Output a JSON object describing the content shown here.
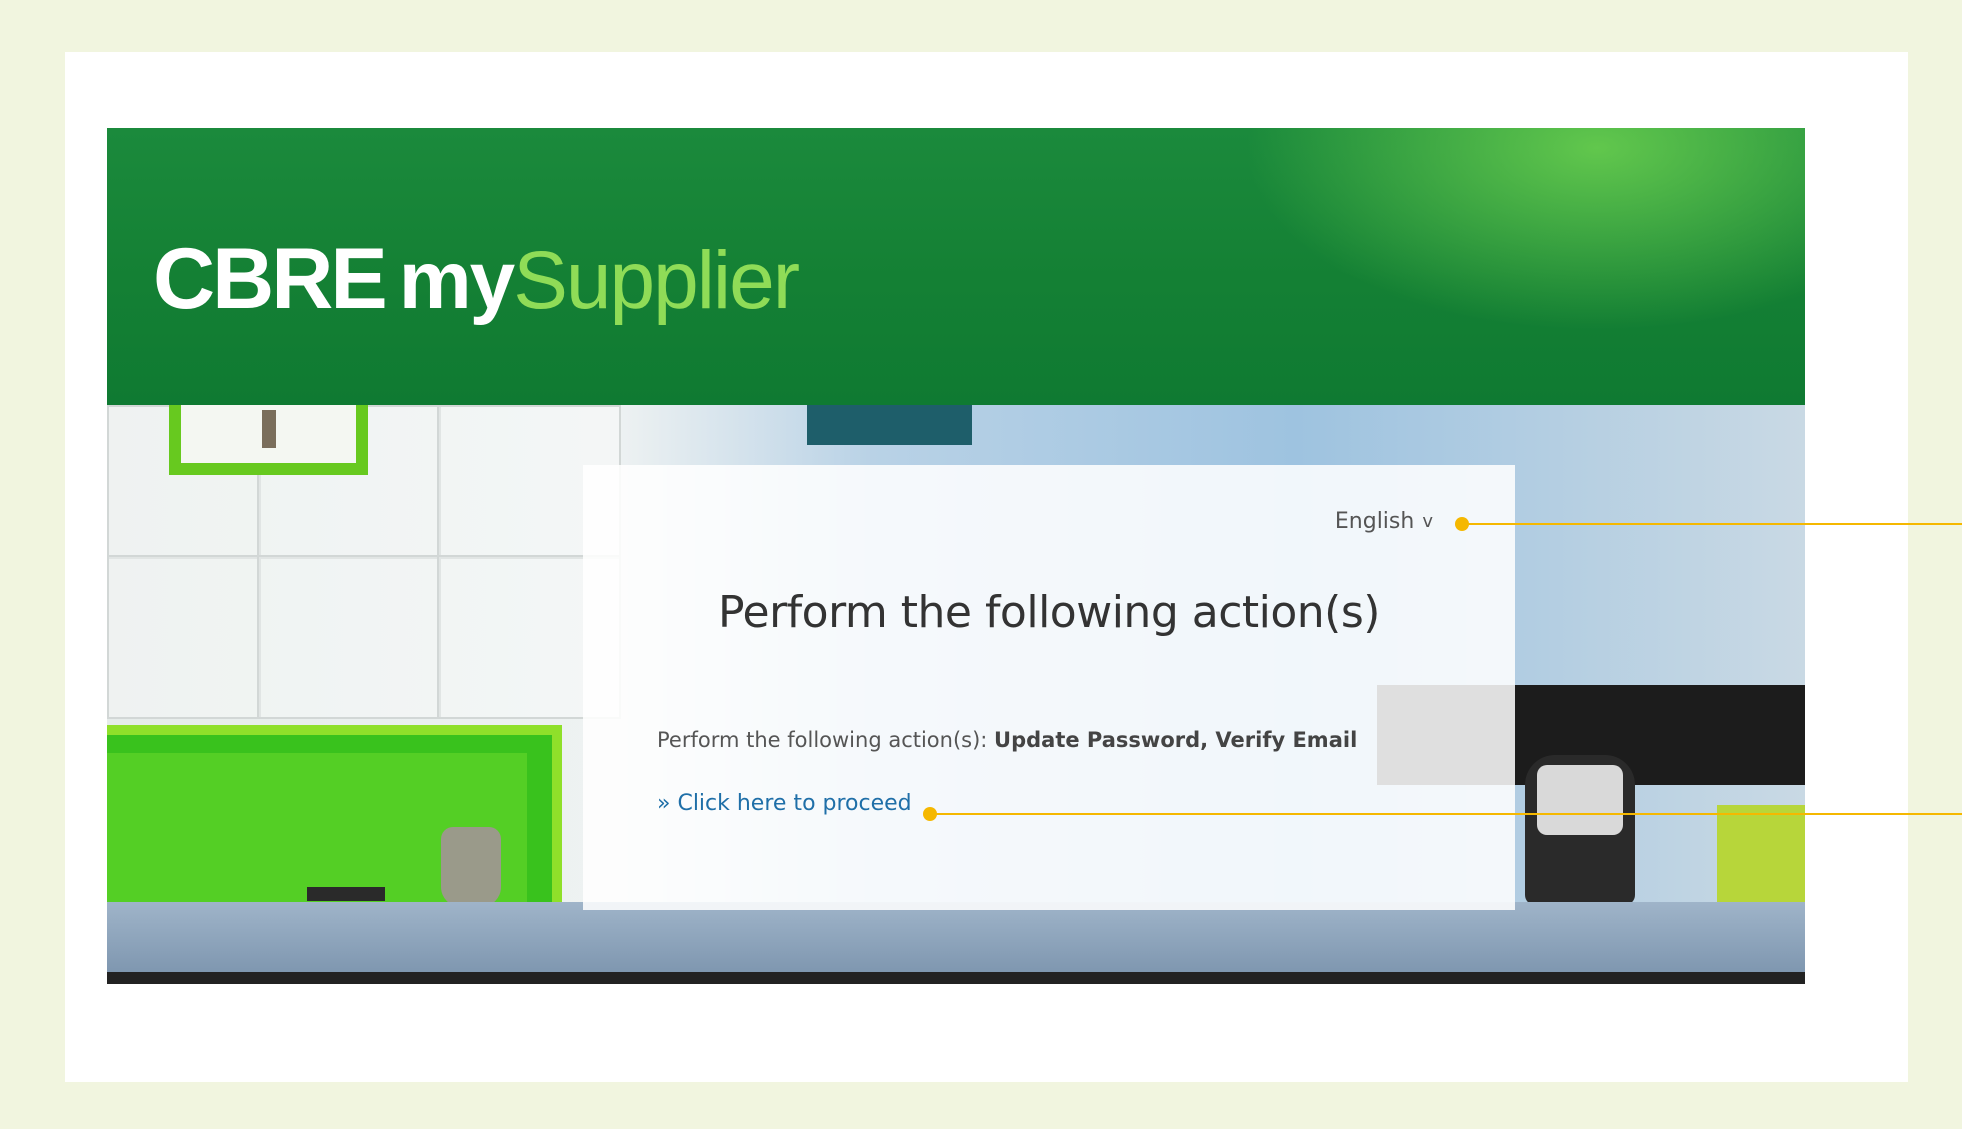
{
  "header": {
    "logo_part1": "CBRE",
    "logo_part2": "my",
    "logo_part3": "Supplier"
  },
  "panel": {
    "language_label": "English",
    "language_chevron": "v",
    "title": "Perform the following action(s)",
    "action_prefix": "Perform the following action(s): ",
    "action_items": "Update Password, Verify Email",
    "proceed_link": "» Click here to proceed"
  },
  "colors": {
    "header_green": "#148034",
    "logo_accent": "#8fdc57",
    "link": "#1f6fa8",
    "callout": "#f5b800",
    "page_background": "#f1f5df"
  },
  "icons": {
    "language_dropdown": "chevron-down-icon"
  }
}
